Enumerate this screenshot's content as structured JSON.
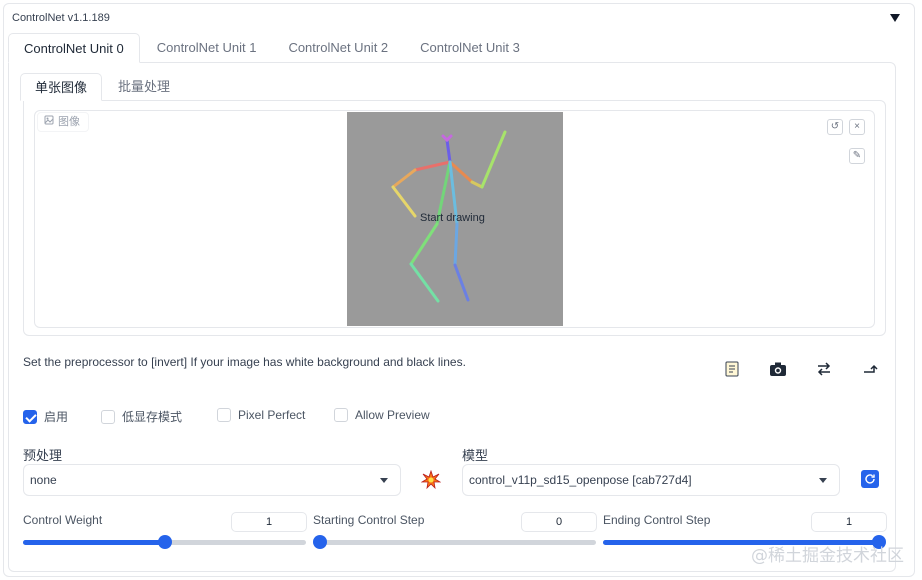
{
  "panel": {
    "title": "ControlNet v1.1.189"
  },
  "unit_tabs": [
    "ControlNet Unit 0",
    "ControlNet Unit 1",
    "ControlNet Unit 2",
    "ControlNet Unit 3"
  ],
  "image_tabs": [
    "单张图像",
    "批量处理"
  ],
  "image_panel": {
    "label": "图像",
    "canvas_text": "Start drawing"
  },
  "hint": "Set the preprocessor to [invert] If your image has white background and black lines.",
  "checkboxes": [
    {
      "label": "启用",
      "checked": true
    },
    {
      "label": "低显存模式",
      "checked": false
    },
    {
      "label": "Pixel Perfect",
      "checked": false
    },
    {
      "label": "Allow Preview",
      "checked": false
    }
  ],
  "preprocessor": {
    "label": "预处理",
    "value": "none"
  },
  "model": {
    "label": "模型",
    "value": "control_v11p_sd15_openpose [cab727d4]"
  },
  "sliders": [
    {
      "label": "Control Weight",
      "value": "1",
      "fraction": 0.5
    },
    {
      "label": "Starting Control Step",
      "value": "0",
      "fraction": 0.0
    },
    {
      "label": "Ending Control Step",
      "value": "1",
      "fraction": 1.0
    }
  ],
  "watermark": "@稀土掘金技术社区",
  "icons": [
    "collapse-arrow-icon",
    "image-icon",
    "undo-icon",
    "close-icon",
    "brush-icon",
    "notepad-icon",
    "camera-icon",
    "swap-icon",
    "send-arrow-icon",
    "explosion-icon",
    "refresh-icon"
  ],
  "colors": {
    "accent": "#2563eb",
    "canvas_bg": "#9a9a9a"
  }
}
